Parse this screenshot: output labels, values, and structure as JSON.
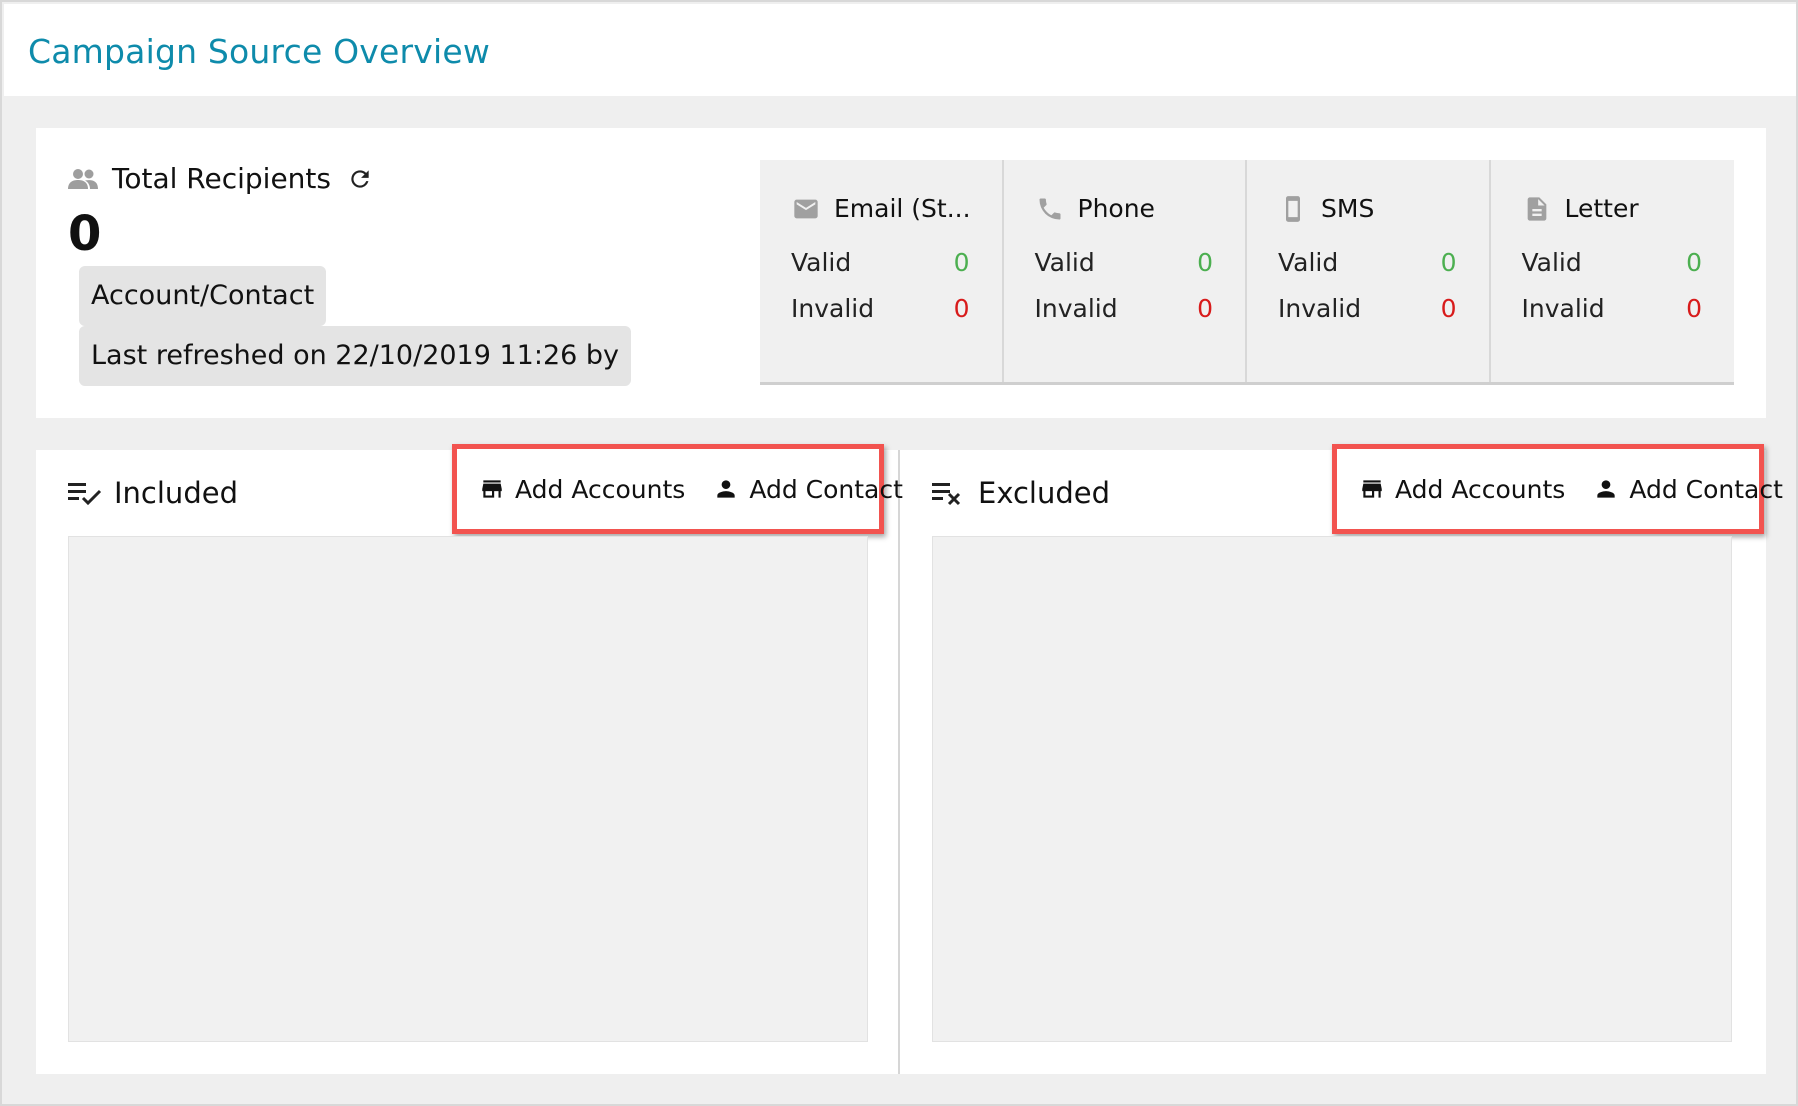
{
  "header": {
    "title": "Campaign Source Overview"
  },
  "summary": {
    "title": "Total Recipients",
    "count": "0",
    "type_chip": "Account/Contact",
    "refreshed_text": "Last refreshed on 22/10/2019 11:26 by"
  },
  "channels": [
    {
      "name": "Email (St...",
      "icon": "email-icon",
      "valid_label": "Valid",
      "valid": "0",
      "invalid_label": "Invalid",
      "invalid": "0"
    },
    {
      "name": "Phone",
      "icon": "phone-icon",
      "valid_label": "Valid",
      "valid": "0",
      "invalid_label": "Invalid",
      "invalid": "0"
    },
    {
      "name": "SMS",
      "icon": "mobile-icon",
      "valid_label": "Valid",
      "valid": "0",
      "invalid_label": "Invalid",
      "invalid": "0"
    },
    {
      "name": "Letter",
      "icon": "document-icon",
      "valid_label": "Valid",
      "valid": "0",
      "invalid_label": "Invalid",
      "invalid": "0"
    }
  ],
  "included": {
    "title": "Included",
    "add_accounts": "Add Accounts",
    "add_contact": "Add Contact"
  },
  "excluded": {
    "title": "Excluded",
    "add_accounts": "Add Accounts",
    "add_contact": "Add Contact"
  },
  "colors": {
    "title": "#0e8bab",
    "valid": "#4caf50",
    "invalid": "#d81b1b",
    "highlight": "#f2534f"
  }
}
